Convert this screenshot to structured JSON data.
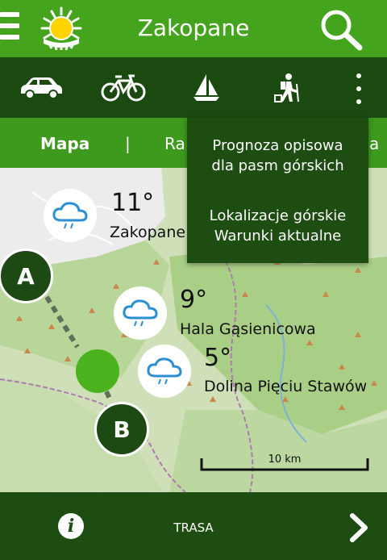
{
  "appbar": {
    "title": "Zakopane",
    "menu_icon": "hamburger-menu-icon",
    "logo_icon": "sun-logo-icon",
    "search_icon": "search-icon",
    "bg_color": "#45a41e"
  },
  "toolbar": {
    "items": [
      "car-icon",
      "bicycle-icon",
      "sailboat-icon",
      "hiker-icon"
    ],
    "more_icon": "more-vertical-icon",
    "bg_color": "#1a4a10"
  },
  "tabs": {
    "active": "Mapa",
    "separator": "|",
    "partial_left": "Ra",
    "partial_right": "a"
  },
  "dropdown": {
    "item1_line1": "Prognoza opisowa",
    "item1_line2": "dla pasm górskich",
    "item2_line1": "Lokalizacje górskie",
    "item2_line2": "Warunki aktualne"
  },
  "map": {
    "locations": [
      {
        "name": "Zakopane",
        "temp": "11°",
        "icon": "cloud-rain-icon"
      },
      {
        "name": "Hala Gąsienicowa",
        "temp": "9°",
        "icon": "cloud-rain-icon"
      },
      {
        "name": "Dolina Pięciu Stawów",
        "temp": "5°",
        "icon": "cloud-rain-icon"
      }
    ],
    "marker_a": "A",
    "marker_b": "B",
    "scale_label": "10 km"
  },
  "bottombar": {
    "info_label": "i",
    "trasa_label": "TRASA",
    "next_icon": "chevron-right-icon"
  }
}
